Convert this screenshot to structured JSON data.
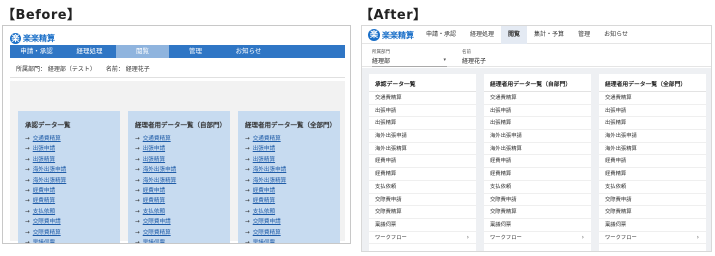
{
  "headings": {
    "before": "【Before】",
    "after": "【After】"
  },
  "before": {
    "logo_mark": "楽",
    "logo_text": "楽楽精算",
    "nav": [
      "申請・承認",
      "経理処理",
      "閲覧",
      "管理",
      "お知らせ"
    ],
    "active_nav": "閲覧",
    "info": {
      "department": "所属部門： 経理部（テスト）",
      "name": "名前： 経理花子"
    },
    "columns": [
      {
        "title": "承認データ一覧",
        "links": [
          "交通費精算",
          "出張申請",
          "出張精算",
          "海外出張申請",
          "海外出張精算",
          "経費申請",
          "経費精算",
          "支払依頼",
          "交際費申請",
          "交際費精算",
          "稟議伺票"
        ]
      },
      {
        "title": "経理者用データ一覧（自部門）",
        "links": [
          "交通費精算",
          "出張申請",
          "出張精算",
          "海外出張申請",
          "海外出張精算",
          "経費申請",
          "経費精算",
          "支払依頼",
          "交際費申請",
          "交際費精算",
          "稟議伺票"
        ]
      },
      {
        "title": "経理者用データ一覧（全部門）",
        "links": [
          "交通費精算",
          "出張申請",
          "出張精算",
          "海外出張申請",
          "海外出張精算",
          "経費申請",
          "経費精算",
          "支払依頼",
          "交際費申請",
          "交際費精算",
          "稟議伺票"
        ]
      }
    ]
  },
  "after": {
    "logo_mark": "楽",
    "logo_text": "楽楽精算",
    "nav": [
      "申請・承認",
      "経理処理",
      "閲覧",
      "集計・予算",
      "管理",
      "お知らせ"
    ],
    "active_nav": "閲覧",
    "info": {
      "dept_label": "所属部門",
      "dept_value": "経理部",
      "name_label": "名前",
      "name_value": "経理花子"
    },
    "columns": [
      {
        "title": "承認データ一覧",
        "items": [
          "交通費精算",
          "出張申請",
          "出張精算",
          "海外出張申請",
          "海外出張精算",
          "経費申請",
          "経費精算",
          "支払依頼",
          "交際費申請",
          "交際費精算",
          "稟議伺票",
          "ワークフロー"
        ]
      },
      {
        "title": "経理者用データ一覧（自部門）",
        "items": [
          "交通費精算",
          "出張申請",
          "出張精算",
          "海外出張申請",
          "海外出張精算",
          "経費申請",
          "経費精算",
          "支払依頼",
          "交際費申請",
          "交際費精算",
          "稟議伺票",
          "ワークフロー"
        ]
      },
      {
        "title": "経理者用データ一覧（全部門）",
        "items": [
          "交通費精算",
          "出張申請",
          "出張精算",
          "海外出張申請",
          "海外出張精算",
          "経費申請",
          "経費精算",
          "支払依頼",
          "交際費申請",
          "交際費精算",
          "稟議伺票",
          "ワークフロー"
        ]
      }
    ]
  },
  "colors": {
    "brand": "#1a6fc8",
    "before_nav": "#2f76c5",
    "before_panel": "#c7dbf0",
    "after_bg": "#eef0f3"
  }
}
